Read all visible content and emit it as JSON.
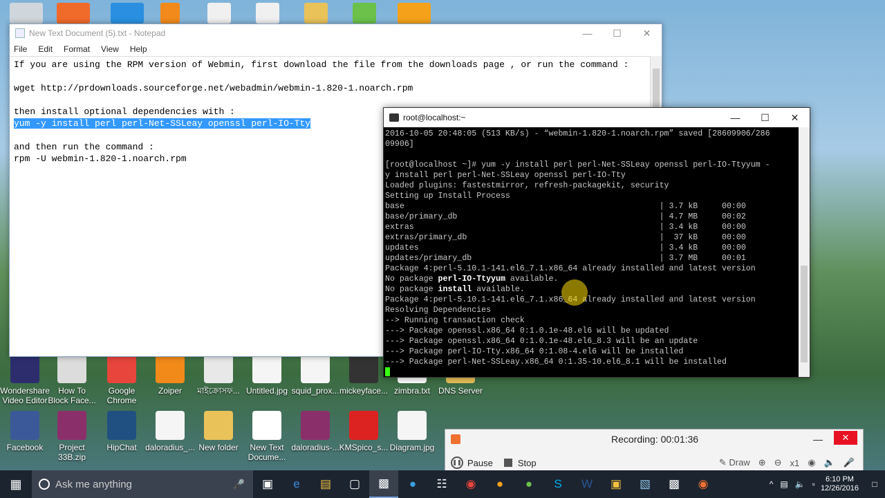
{
  "desktop_icons_row1": [
    {
      "label": "Wondershare Video Editor",
      "icon": "wondershare-icon",
      "color": "#2d2d6e"
    },
    {
      "label": "How To Block Face...",
      "icon": "document-icon",
      "color": "#dcdcdc"
    },
    {
      "label": "Google Chrome",
      "icon": "chrome-icon",
      "color": "#e8453c"
    },
    {
      "label": "Zoiper",
      "icon": "zoiper-icon",
      "color": "#f28a1a"
    },
    {
      "label": "মাইক্রোসফ...",
      "icon": "pdf-icon",
      "color": "#e8e8e8"
    },
    {
      "label": "Untitled.jpg",
      "icon": "image-icon",
      "color": "#f5f5f5"
    },
    {
      "label": "squid_prox...",
      "icon": "image-icon",
      "color": "#f5f5f5"
    },
    {
      "label": "mickeyface...",
      "icon": "mickey-icon",
      "color": "#333333"
    },
    {
      "label": "zimbra.txt",
      "icon": "text-file-icon",
      "color": "#ffffff"
    },
    {
      "label": "DNS Server",
      "icon": "folder-icon",
      "color": "#e9c25a"
    }
  ],
  "desktop_icons_row2": [
    {
      "label": "Facebook",
      "icon": "facebook-icon",
      "color": "#3b5998"
    },
    {
      "label": "Project 33B.zip",
      "icon": "winrar-icon",
      "color": "#8b2f6b"
    },
    {
      "label": "HipChat",
      "icon": "hipchat-icon",
      "color": "#205081"
    },
    {
      "label": "daloradius_...",
      "icon": "document-icon",
      "color": "#f5f5f5"
    },
    {
      "label": "New folder",
      "icon": "folder-icon",
      "color": "#e9c25a"
    },
    {
      "label": "New Text Docume...",
      "icon": "text-file-icon",
      "color": "#ffffff"
    },
    {
      "label": "daloradius-...",
      "icon": "winrar-icon",
      "color": "#8b2f6b"
    },
    {
      "label": "KMSpico_s...",
      "icon": "kmspico-icon",
      "color": "#d22"
    },
    {
      "label": "Diagram.jpg",
      "icon": "image-icon",
      "color": "#f5f5f5"
    }
  ],
  "notepad": {
    "title": "New Text Document (5).txt - Notepad",
    "menu": [
      "File",
      "Edit",
      "Format",
      "View",
      "Help"
    ],
    "line1": "If you are using the RPM version of Webmin, first download the file from the downloads page , or run the command :",
    "line2": "",
    "line3": "wget http://prdownloads.sourceforge.net/webadmin/webmin-1.820-1.noarch.rpm",
    "line4": "",
    "line5": "then install optional dependencies with :",
    "line6_selected": "yum -y install perl perl-Net-SSLeay openssl perl-IO-Tty",
    "line7": "",
    "line8": "and then run the command :",
    "line9": "rpm -U webmin-1.820-1.noarch.rpm"
  },
  "terminal": {
    "title": "root@localhost:~",
    "lines": [
      "2016-10-05 20:48:05 (513 KB/s) - “webmin-1.820-1.noarch.rpm” saved [28609906/286",
      "09906]",
      "",
      "[root@localhost ~]# yum -y install perl perl-Net-SSLeay openssl perl-IO-Ttyyum -",
      "y install perl perl-Net-SSLeay openssl perl-IO-Tty",
      "Loaded plugins: fastestmirror, refresh-packagekit, security",
      "Setting up Install Process",
      "base                                                     | 3.7 kB     00:00",
      "base/primary_db                                          | 4.7 MB     00:02",
      "extras                                                   | 3.4 kB     00:00",
      "extras/primary_db                                        |  37 kB     00:00",
      "updates                                                  | 3.4 kB     00:00",
      "updates/primary_db                                       | 3.7 MB     00:01",
      "Package 4:perl-5.10.1-141.el6_7.1.x86_64 already installed and latest version"
    ],
    "nopkg1_prefix": "No package ",
    "nopkg1_bold": "perl-IO-Ttyyum",
    "nopkg1_suffix": " available.",
    "nopkg2_prefix": "No package ",
    "nopkg2_bold": "install",
    "nopkg2_suffix": " available.",
    "lines2": [
      "Package 4:perl-5.10.1-141.el6_7.1.x86_64 already installed and latest version",
      "Resolving Dependencies",
      "--> Running transaction check",
      "---> Package openssl.x86_64 0:1.0.1e-48.el6 will be updated",
      "---> Package openssl.x86_64 0:1.0.1e-48.el6_8.3 will be an update",
      "---> Package perl-IO-Tty.x86_64 0:1.08-4.el6 will be installed",
      "---> Package perl-Net-SSLeay.x86_64 0:1.35-10.el6_8.1 will be installed"
    ]
  },
  "recorder": {
    "status": "Recording:  00:01:36",
    "pause": "Pause",
    "stop": "Stop",
    "draw": "Draw",
    "zoom": "x1"
  },
  "taskbar": {
    "search_placeholder": "Ask me anything",
    "date": "12/26/2016",
    "time": "6:10 PM"
  }
}
